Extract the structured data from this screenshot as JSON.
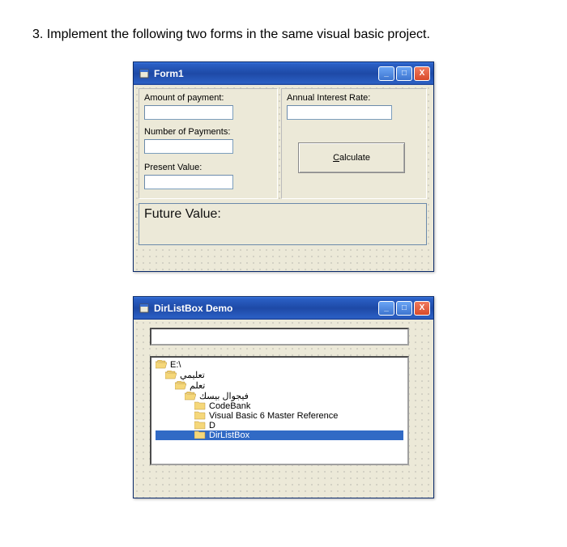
{
  "question": "3. Implement the following two forms in the same visual basic project.",
  "form1": {
    "title": "Form1",
    "labels": {
      "amount": "Amount of payment:",
      "rate": "Annual Interest Rate:",
      "num": "Number of Payments:",
      "present": "Present Value:",
      "future": "Future Value:"
    },
    "button": {
      "calc_prefix": "C",
      "calc_rest": "alculate"
    }
  },
  "form2": {
    "title": "DirListBox Demo",
    "dirs": [
      {
        "label": "E:\\",
        "open": true,
        "indent": 0
      },
      {
        "label": "تعليمي",
        "open": true,
        "indent": 1
      },
      {
        "label": "تعلم",
        "open": true,
        "indent": 2
      },
      {
        "label": "فيجوال بيسك",
        "open": true,
        "indent": 3
      },
      {
        "label": "CodeBank",
        "open": false,
        "indent": 4
      },
      {
        "label": "Visual Basic 6 Master Reference",
        "open": false,
        "indent": 4
      },
      {
        "label": "D",
        "open": false,
        "indent": 4
      },
      {
        "label": "DirListBox",
        "open": false,
        "indent": 5,
        "selected": true
      }
    ]
  },
  "winbuttons": {
    "min": "_",
    "max": "□",
    "close": "X"
  }
}
